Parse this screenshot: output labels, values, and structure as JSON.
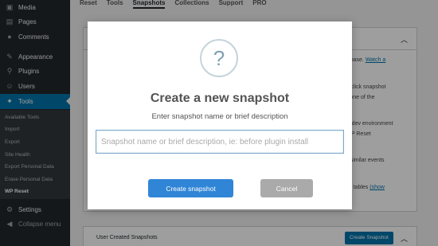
{
  "sidebar": {
    "items": [
      {
        "label": "Media",
        "icon": "media-icon",
        "glyph": "▣"
      },
      {
        "label": "Pages",
        "icon": "page-icon",
        "glyph": "▤"
      },
      {
        "label": "Comments",
        "icon": "comment-icon",
        "glyph": "●"
      },
      {
        "label": "Appearance",
        "icon": "brush-icon",
        "glyph": "✎"
      },
      {
        "label": "Plugins",
        "icon": "plug-icon",
        "glyph": "⚲"
      },
      {
        "label": "Users",
        "icon": "user-icon",
        "glyph": "☺"
      },
      {
        "label": "Tools",
        "icon": "wrench-icon",
        "glyph": "✦"
      }
    ],
    "submenu": [
      "Available Tools",
      "Import",
      "Export",
      "Site Health",
      "Export Personal Data",
      "Erase Personal Data",
      "WP Reset"
    ],
    "settings": {
      "label": "Settings",
      "glyph": "⚙"
    },
    "collapse": {
      "label": "Collapse menu",
      "glyph": "◀"
    }
  },
  "tabs": [
    "Reset",
    "Tools",
    "Snapshots",
    "Collections",
    "Support",
    "PRO"
  ],
  "background": {
    "line1": "atabase. ",
    "line1_link": "Watch a",
    "line2": "r 1-click snapshot",
    "line3": "se one of the",
    "line4": "the dev environment",
    "line5": "r WP Reset",
    "line6": "ad similar events",
    "line7": "tom tables ",
    "line7_link": "(show",
    "bottom_title": "User Created Snapshots",
    "bottom_button": "Create Snapshot"
  },
  "modal": {
    "icon_glyph": "?",
    "title": "Create a new snapshot",
    "subtitle": "Enter snapshot name or brief description",
    "input_value": "",
    "input_placeholder": "Snapshot name or brief description, ie: before plugin install",
    "create_label": "Create snapshot",
    "cancel_label": "Cancel"
  },
  "colors": {
    "sidebar": "#23282d",
    "active": "#0073aa",
    "create_button": "#3085d6",
    "cancel_button": "#aaaaaa"
  }
}
